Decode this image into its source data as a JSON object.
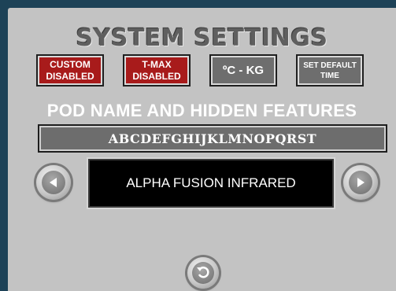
{
  "title": "SYSTEM SETTINGS",
  "buttons": {
    "custom": "CUSTOM DISABLED",
    "tmax": "T-MAX DISABLED",
    "units": "ºC - KG",
    "set_default_time": "SET DEFAULT TIME"
  },
  "section_heading": "POD NAME AND HIDDEN FEATURES",
  "code_field": "ABCDEFGHIJKLMNOPQRST",
  "pod_name": "ALPHA FUSION INFRARED",
  "icons": {
    "prev": "chevron-left-icon",
    "next": "chevron-right-icon",
    "back": "return-icon"
  },
  "colors": {
    "background": "#1d4257",
    "panel": "#c3c3c3",
    "disabled_red": "#a81b1b",
    "button_gray": "#6e6e6e"
  }
}
